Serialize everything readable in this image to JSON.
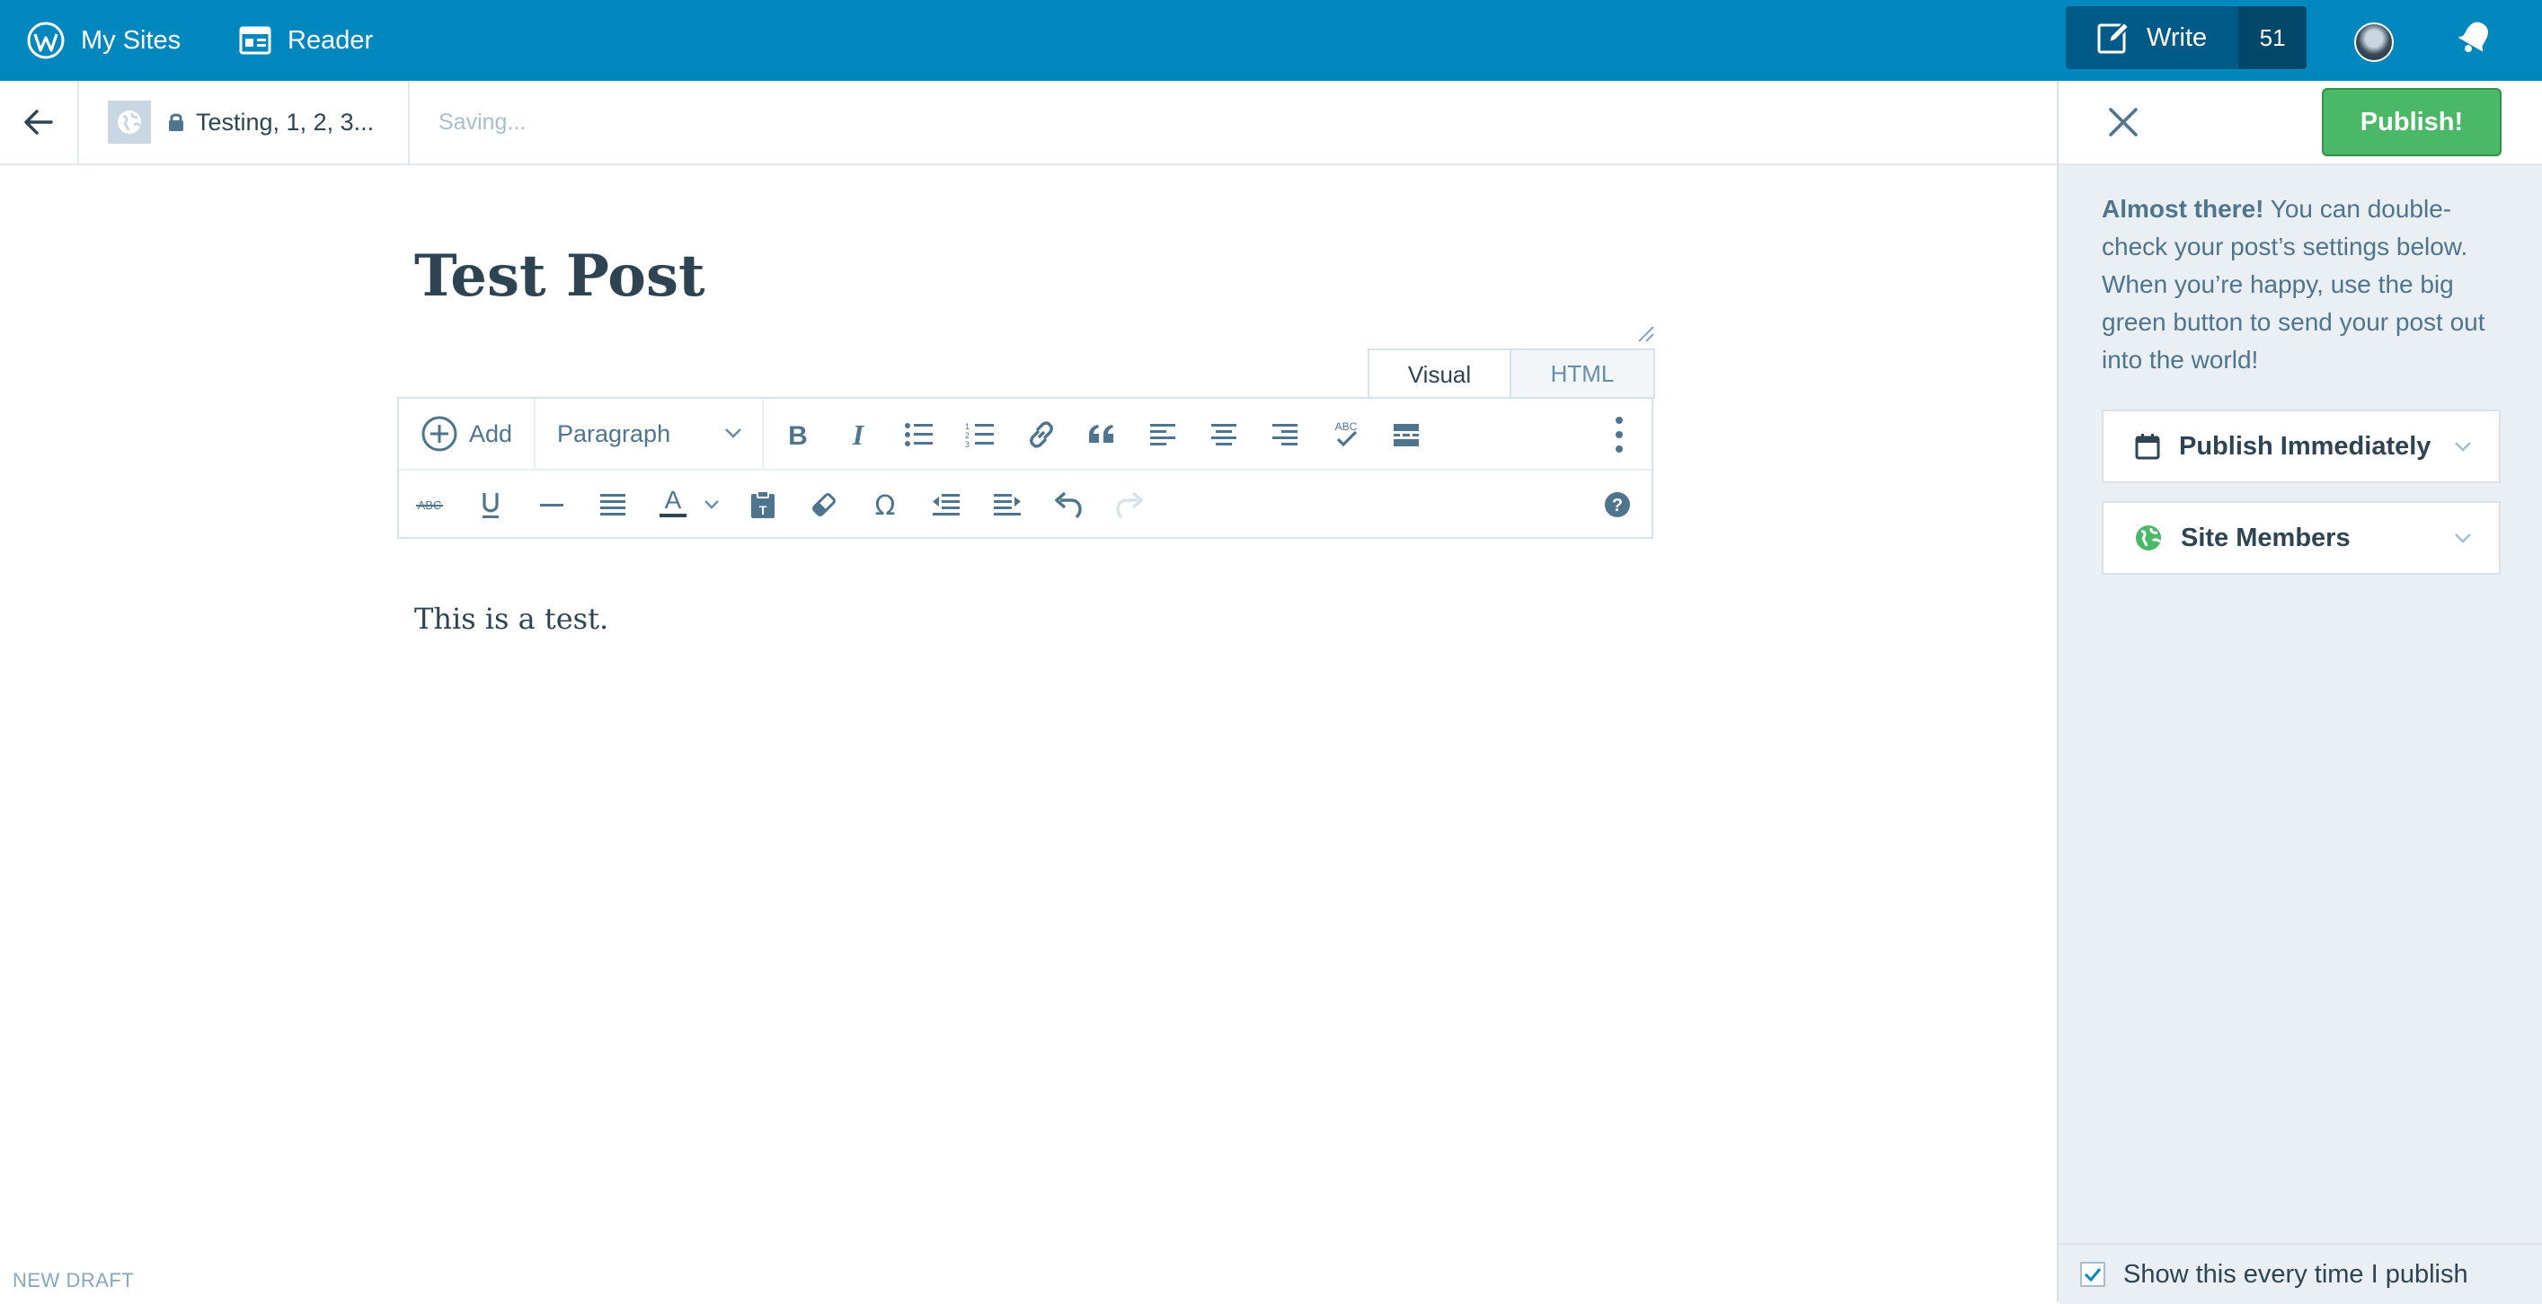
{
  "masterbar": {
    "my_sites": "My Sites",
    "reader": "Reader",
    "write": "Write",
    "write_count": "51"
  },
  "editor_bar": {
    "site_name": "Testing, 1, 2, 3...",
    "saving": "Saving..."
  },
  "post": {
    "title": "Test Post",
    "content": "This is a test.",
    "status": "NEW DRAFT"
  },
  "tabs": {
    "visual": "Visual",
    "html": "HTML"
  },
  "toolbar": {
    "add": "Add",
    "format_select": "Paragraph",
    "row1_icons": [
      "bold-icon",
      "italic-icon",
      "bullet-list-icon",
      "numbered-list-icon",
      "link-icon",
      "blockquote-icon",
      "align-left-icon",
      "align-center-icon",
      "align-right-icon",
      "spellcheck-icon",
      "read-more-icon",
      "more-options-icon"
    ],
    "row2_icons": [
      "strikethrough-icon",
      "underline-icon",
      "horizontal-rule-icon",
      "justify-icon",
      "text-color-icon",
      "paste-text-icon",
      "clear-formatting-icon",
      "special-character-icon",
      "outdent-icon",
      "indent-icon",
      "undo-icon",
      "redo-icon",
      "help-icon"
    ]
  },
  "sidebar": {
    "publish_button": "Publish!",
    "intro_bold": "Almost there!",
    "intro_text": " You can double-check your post’s settings below. When you’re happy, use the big green button to send your post out into the world!",
    "schedule": "Publish Immediately",
    "visibility": "Site Members",
    "show_every_time": "Show this every time I publish",
    "show_every_time_checked": true
  },
  "colors": {
    "masterbar": "#0087be",
    "write_button": "#005a87",
    "publish_green": "#4ab866",
    "sidebar_bg": "#e9eff3",
    "text_dark": "#2e4453"
  }
}
